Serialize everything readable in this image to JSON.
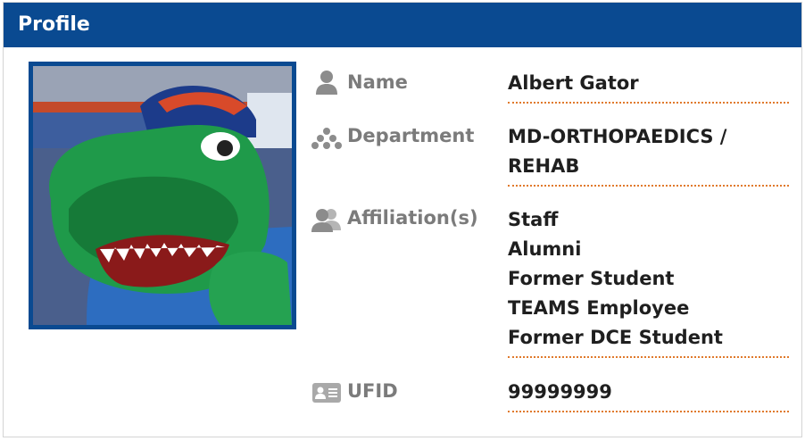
{
  "header": {
    "title": "Profile"
  },
  "profile": {
    "name_label": "Name",
    "name_value": "Albert Gator",
    "department_label": "Department",
    "department_line1": "MD-ORTHOPAEDICS /",
    "department_line2": "REHAB",
    "affiliation_label": "Affiliation(s)",
    "affiliations": [
      "Staff",
      "Alumni",
      "Former Student",
      "TEAMS Employee",
      "Former DCE Student"
    ],
    "ufid_label": "UFID",
    "ufid_value": "99999999"
  },
  "icons": {
    "name": "person-icon",
    "department": "org-cluster-icon",
    "affiliation": "people-group-icon",
    "ufid": "id-card-icon"
  },
  "colors": {
    "header_bg": "#0a4a91",
    "label": "#7b7b7b",
    "value": "#1f1f1f",
    "underline": "#e07a2c"
  }
}
